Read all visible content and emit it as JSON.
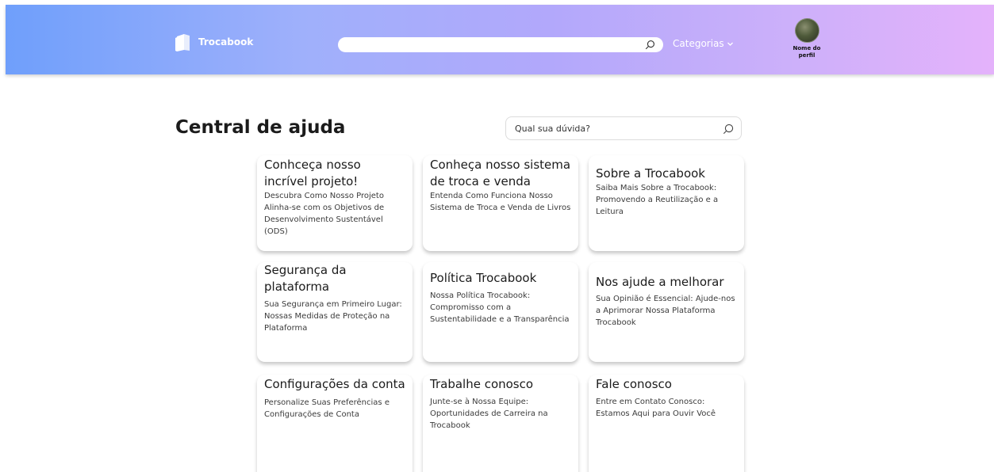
{
  "header": {
    "brand": "Trocabook",
    "categories_label": "Categorias",
    "profile_name": "Nome do perfil"
  },
  "page": {
    "title": "Central de ajuda",
    "search_placeholder": "Qual sua dúvida?"
  },
  "cards": [
    {
      "title": "Conhceça nosso incrível projeto!",
      "description": "Descubra Como Nosso Projeto Alinha-se com os Objetivos de Desenvolvimento Sustentável (ODS)"
    },
    {
      "title": "Conheça nosso sistema de troca e venda",
      "description": "Entenda Como Funciona Nosso Sistema de Troca e Venda de Livros"
    },
    {
      "title": "Sobre a Trocabook",
      "description": "Saiba Mais Sobre a Trocabook: Promovendo a Reutilização e a Leitura"
    },
    {
      "title": "Segurança da plataforma",
      "description": "Sua Segurança em Primeiro Lugar: Nossas Medidas de Proteção na Plataforma"
    },
    {
      "title": "Política Trocabook",
      "description": "Nossa Política Trocabook: Compromisso com a Sustentabilidade e a Transparência"
    },
    {
      "title": "Nos ajude a melhorar",
      "description": "Sua Opinião é Essencial: Ajude-nos a Aprimorar Nossa Plataforma Trocabook"
    },
    {
      "title": "Configurações da conta",
      "description": "Personalize Suas Preferências e Configurações de Conta"
    },
    {
      "title": "Trabalhe conosco",
      "description": "Junte-se à Nossa Equipe: Oportunidades de Carreira na Trocabook"
    },
    {
      "title": "Fale conosco",
      "description": "Entre em Contato Conosco: Estamos Aqui para Ouvir Você"
    }
  ]
}
